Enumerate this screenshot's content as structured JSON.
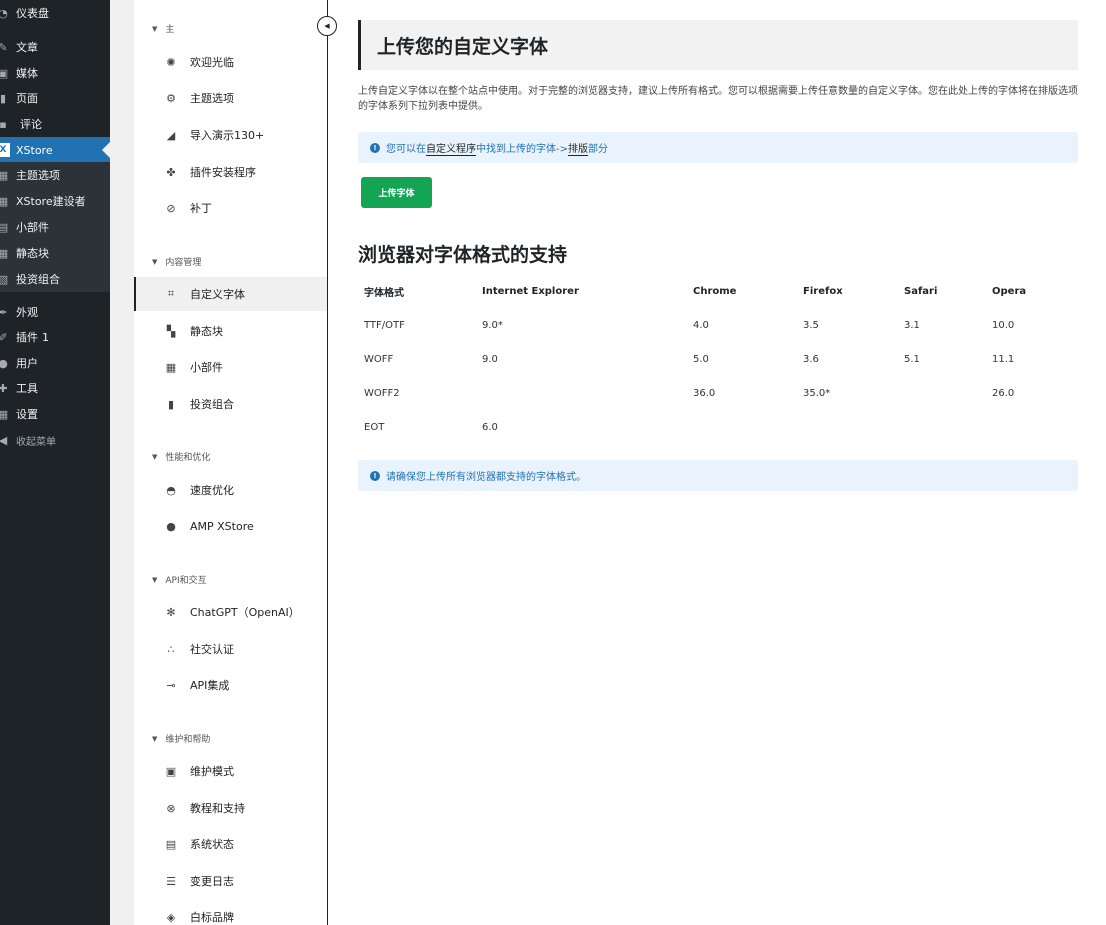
{
  "wp_menu": {
    "dashboard": "仪表盘",
    "posts": "文章",
    "media": "媒体",
    "pages": "页面",
    "comments": "评论",
    "xstore": "XStore",
    "sub": [
      "主题选项",
      "XStore建设者",
      "小部件",
      "静态块",
      "投资组合"
    ],
    "appearance": "外观",
    "plugins": "插件",
    "plugins_badge": "1",
    "users": "用户",
    "tools": "工具",
    "settings": "设置",
    "collapse": "收起菜单"
  },
  "xs_nav": {
    "sections": [
      {
        "title": "主",
        "items": [
          "欢迎光临",
          "主题选项",
          "导入演示130+",
          "插件安装程序",
          "补丁"
        ]
      },
      {
        "title": "内容管理",
        "items": [
          "自定义字体",
          "静态块",
          "小部件",
          "投资组合"
        ]
      },
      {
        "title": "性能和优化",
        "items": [
          "速度优化",
          "AMP XStore"
        ]
      },
      {
        "title": "API和交互",
        "items": [
          "ChatGPT（OpenAI）",
          "社交认证",
          "API集成"
        ]
      },
      {
        "title": "维护和帮助",
        "items": [
          "维护模式",
          "教程和支持",
          "系统状态",
          "变更日志",
          "白标品牌"
        ]
      }
    ],
    "current": "自定义字体"
  },
  "main": {
    "title": "上传您的自定义字体",
    "description": "上传自定义字体以在整个站点中使用。对于完整的浏览器支持，建议上传所有格式。您可以根据需要上传任意数量的自定义字体。您在此处上传的字体将在排版选项的字体系列下拉列表中提供。",
    "notice1": {
      "prefix": "您可以在",
      "link1": "自定义程序",
      "mid": "中找到上传的字体->",
      "link2": "排版",
      "suffix": "部分"
    },
    "upload_button": "上传字体",
    "support_title": "浏览器对字体格式的支持",
    "table": {
      "headers": [
        "字体格式",
        "Internet Explorer",
        "Chrome",
        "Firefox",
        "Safari",
        "Opera"
      ],
      "rows": [
        [
          "TTF/OTF",
          "9.0*",
          "4.0",
          "3.5",
          "3.1",
          "10.0"
        ],
        [
          "WOFF",
          "9.0",
          "5.0",
          "3.6",
          "5.1",
          "11.1"
        ],
        [
          "WOFF2",
          "",
          "36.0",
          "35.0*",
          "",
          "26.0"
        ],
        [
          "EOT",
          "6.0",
          "",
          "",
          "",
          ""
        ]
      ]
    },
    "notice2": "请确保您上传所有浏览器都支持的字体格式。"
  }
}
